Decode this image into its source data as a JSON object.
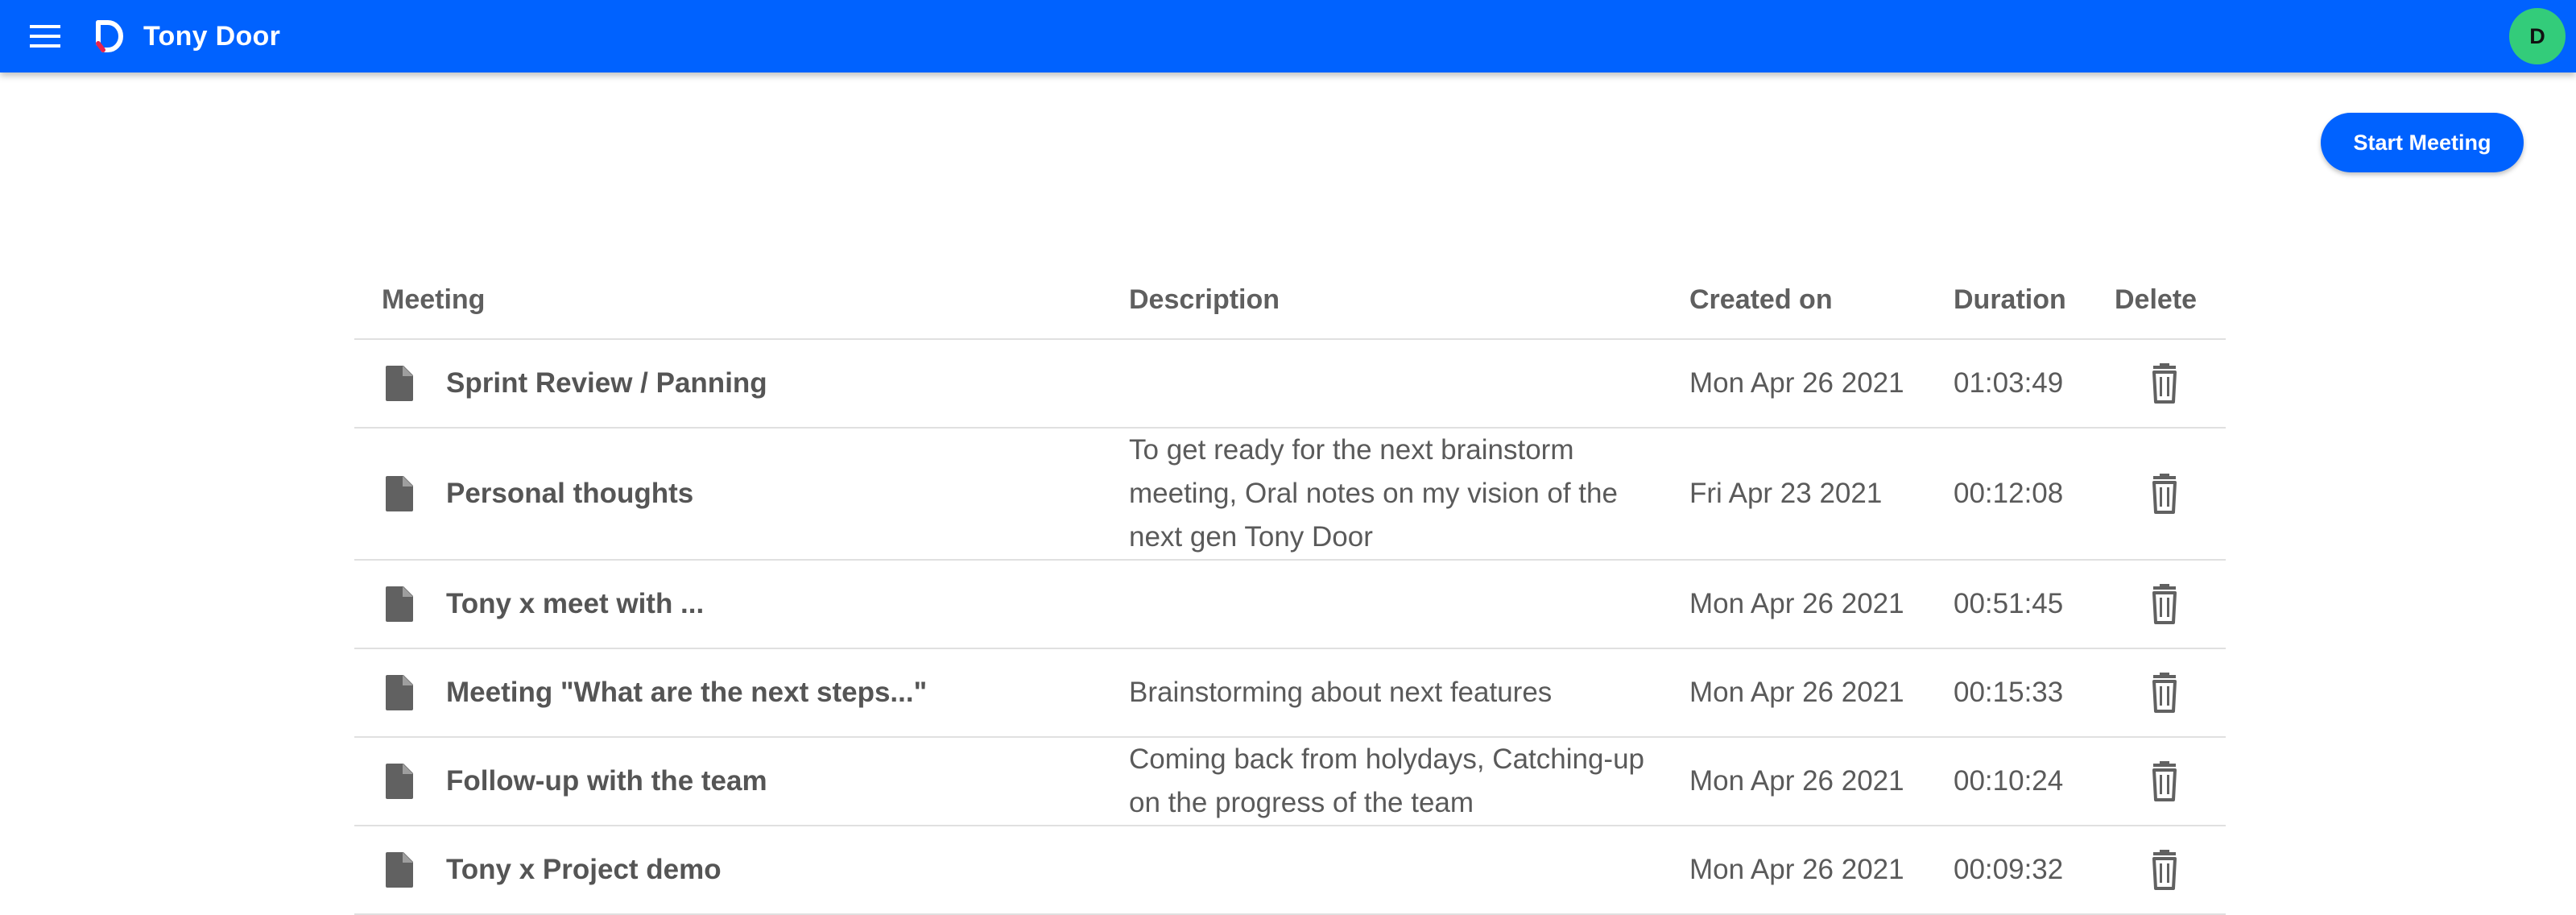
{
  "app": {
    "title": "Tony Door",
    "avatar_initial": "D",
    "colors": {
      "primary": "#0062ff",
      "avatar": "#33cc7a",
      "icon": "#616161"
    }
  },
  "toolbar": {
    "start_meeting_label": "Start Meeting"
  },
  "table": {
    "headers": {
      "meeting": "Meeting",
      "description": "Description",
      "created_on": "Created on",
      "duration": "Duration",
      "delete": "Delete"
    },
    "rows": [
      {
        "name": "Sprint Review / Panning",
        "description": "",
        "created_on": "Mon Apr 26 2021",
        "duration": "01:03:49"
      },
      {
        "name": "Personal thoughts",
        "description": "To get ready for the next brainstorm meeting, Oral notes on my vision of the next gen Tony Door",
        "created_on": "Fri Apr 23 2021",
        "duration": "00:12:08"
      },
      {
        "name": "Tony x meet with ...",
        "description": "",
        "created_on": "Mon Apr 26 2021",
        "duration": "00:51:45"
      },
      {
        "name": "Meeting \"What are the next steps...\"",
        "description": "Brainstorming about next features",
        "created_on": "Mon Apr 26 2021",
        "duration": "00:15:33"
      },
      {
        "name": "Follow-up with the team",
        "description": "Coming back from holydays, Catching-up on the progress of the team",
        "created_on": "Mon Apr 26 2021",
        "duration": "00:10:24"
      },
      {
        "name": "Tony x Project demo",
        "description": "",
        "created_on": "Mon Apr 26 2021",
        "duration": "00:09:32"
      }
    ]
  }
}
